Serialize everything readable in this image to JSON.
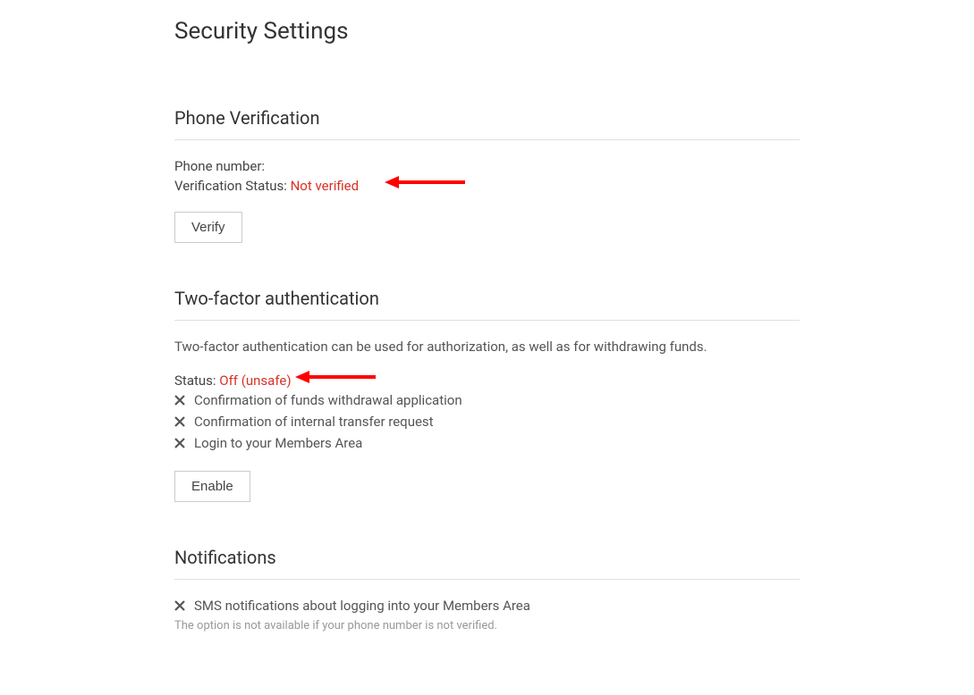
{
  "pageTitle": "Security Settings",
  "phoneSection": {
    "title": "Phone Verification",
    "phoneNumberLabel": "Phone number:",
    "phoneNumberValue": "",
    "verificationStatusLabel": "Verification Status:",
    "verificationStatusValue": "Not verified",
    "buttonLabel": "Verify"
  },
  "twoFactorSection": {
    "title": "Two-factor authentication",
    "description": "Two-factor authentication can be used for authorization, as well as for withdrawing funds.",
    "statusLabel": "Status:",
    "statusValue": "Off (unsafe)",
    "items": [
      "Confirmation of funds withdrawal application",
      "Confirmation of internal transfer request",
      "Login to your Members Area"
    ],
    "buttonLabel": "Enable"
  },
  "notificationsSection": {
    "title": "Notifications",
    "items": [
      "SMS notifications about logging into your Members Area"
    ],
    "note": "The option is not available if your phone number is not verified."
  }
}
